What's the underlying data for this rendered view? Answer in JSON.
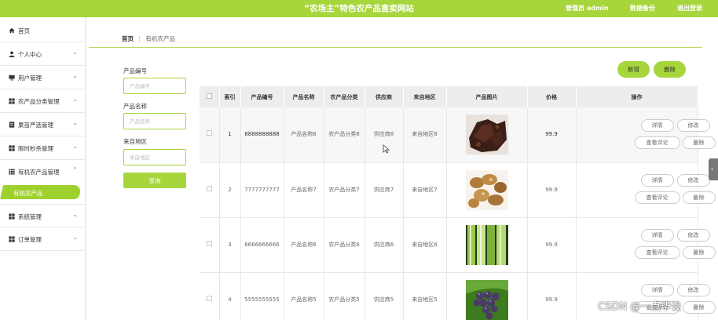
{
  "header": {
    "title": "“农场主”特色农产品直卖网站",
    "admin": "管理员 admin",
    "backup": "数据备份",
    "logout": "退出登录"
  },
  "sidebar": {
    "items": [
      {
        "label": "首页",
        "icon": "home-icon"
      },
      {
        "label": "个人中心",
        "icon": "user-icon"
      },
      {
        "label": "用户管理",
        "icon": "monitor-icon"
      },
      {
        "label": "农产品分类管理",
        "icon": "grid-icon"
      },
      {
        "label": "果苗严选管理",
        "icon": "document-icon"
      },
      {
        "label": "限时秒杀管理",
        "icon": "grid-icon"
      },
      {
        "label": "有机农产品管理",
        "icon": "apps-icon"
      },
      {
        "label": "系统管理",
        "icon": "grid-icon"
      },
      {
        "label": "订单管理",
        "icon": "grid-icon"
      }
    ],
    "active_sub": "有机农产品"
  },
  "breadcrumb": {
    "home": "首页",
    "current": "有机农产品"
  },
  "filters": {
    "code_label": "产品编号",
    "code_placeholder": "产品编号",
    "name_label": "产品名称",
    "name_placeholder": "产品名称",
    "region_label": "来自地区",
    "region_placeholder": "来自地区",
    "query": "查询"
  },
  "actions": {
    "add": "新增",
    "delete": "删除"
  },
  "table": {
    "headers": [
      "索引",
      "产品编号",
      "产品名称",
      "农产品分类",
      "供应商",
      "来自地区",
      "产品图片",
      "价格",
      "操作"
    ],
    "ops": {
      "detail": "详情",
      "edit": "修改",
      "review": "查看评论",
      "delete": "删除"
    },
    "rows": [
      {
        "index": "1",
        "code": "8888888888",
        "name": "产品名称8",
        "category": "农产品分类8",
        "supplier": "供应商8",
        "region": "来自地区8",
        "image": "brown-chunks",
        "price": "99.9"
      },
      {
        "index": "2",
        "code": "7777777777",
        "name": "产品名称7",
        "category": "农产品分类7",
        "supplier": "供应商7",
        "region": "来自地区7",
        "image": "mushrooms",
        "price": "99.9"
      },
      {
        "index": "3",
        "code": "6666666666",
        "name": "产品名称6",
        "category": "农产品分类6",
        "supplier": "供应商6",
        "region": "来自地区6",
        "image": "leeks",
        "price": "99.9"
      },
      {
        "index": "4",
        "code": "5555555555",
        "name": "产品名称5",
        "category": "农产品分类5",
        "supplier": "供应商5",
        "region": "来自地区5",
        "image": "grapes",
        "price": "99.9"
      }
    ]
  },
  "watermark": "CSDN @一点毕设",
  "colors": {
    "accent": "#a6d63c",
    "header_bg": "#ededed"
  }
}
